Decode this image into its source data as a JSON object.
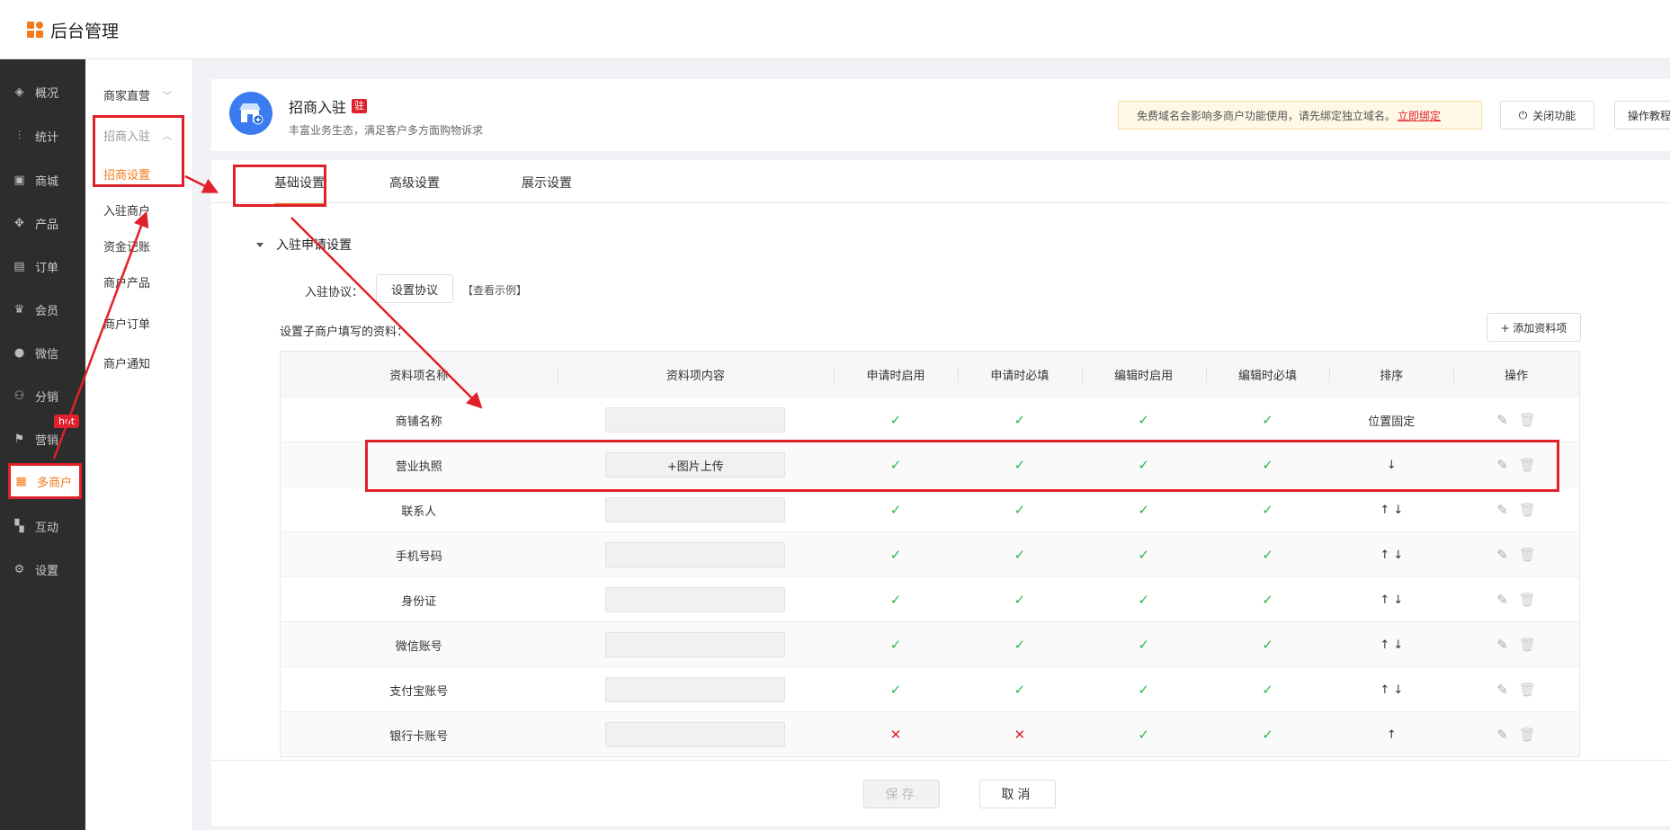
{
  "app": {
    "title": "后台管理"
  },
  "sidebar": {
    "items": [
      {
        "label": "概况",
        "icon": "layers-icon"
      },
      {
        "label": "统计",
        "icon": "stats-icon"
      },
      {
        "label": "商城",
        "icon": "shop-icon"
      },
      {
        "label": "产品",
        "icon": "grid-icon"
      },
      {
        "label": "订单",
        "icon": "order-icon"
      },
      {
        "label": "会员",
        "icon": "crown-icon"
      },
      {
        "label": "微信",
        "icon": "chat-icon"
      },
      {
        "label": "分销",
        "icon": "user-share-icon"
      },
      {
        "label": "营销",
        "icon": "flag-icon"
      },
      {
        "label": "多商户",
        "icon": "store-icon"
      },
      {
        "label": "互动",
        "icon": "apps-icon"
      },
      {
        "label": "设置",
        "icon": "gear-icon"
      }
    ],
    "hot_badge": "hot"
  },
  "submenu": {
    "group1": "商家直营",
    "group2": "招商入驻",
    "items": [
      "招商设置",
      "入驻商户",
      "资金记账",
      "商户产品",
      "商户订单",
      "商户通知"
    ]
  },
  "header": {
    "title": "招商入驻",
    "badge": "驻",
    "subtitle": "丰富业务生态，满足客户多方面购物诉求",
    "notice_text": "免费域名会影响多商户功能使用，请先绑定独立域名。",
    "notice_link": "立即绑定",
    "close_button": "关闭功能",
    "guide_button": "操作教程"
  },
  "tabs": [
    "基础设置",
    "高级设置",
    "展示设置"
  ],
  "section": {
    "title": "入驻申请设置",
    "agreement_label": "入驻协议：",
    "agreement_button": "设置协议",
    "see_example": "【查看示例】",
    "fields_label": "设置子商户填写的资料：",
    "add_button": "+ 添加资料项"
  },
  "table": {
    "headers": [
      "资料项名称",
      "资料项内容",
      "申请时启用",
      "申请时必填",
      "编辑时启用",
      "编辑时必填",
      "排序",
      "操作"
    ],
    "rows": [
      {
        "name": "商铺名称",
        "content": "",
        "flags": [
          "check",
          "check",
          "check",
          "check"
        ],
        "sort": "位置固定"
      },
      {
        "name": "营业执照",
        "content": "+图片上传",
        "flags": [
          "check",
          "check",
          "check",
          "check"
        ],
        "sort": "↓"
      },
      {
        "name": "联系人",
        "content": "",
        "flags": [
          "check",
          "check",
          "check",
          "check"
        ],
        "sort": "↑ ↓"
      },
      {
        "name": "手机号码",
        "content": "",
        "flags": [
          "check",
          "check",
          "check",
          "check"
        ],
        "sort": "↑ ↓"
      },
      {
        "name": "身份证",
        "content": "",
        "flags": [
          "check",
          "check",
          "check",
          "check"
        ],
        "sort": "↑ ↓"
      },
      {
        "name": "微信账号",
        "content": "",
        "flags": [
          "check",
          "check",
          "check",
          "check"
        ],
        "sort": "↑ ↓"
      },
      {
        "name": "支付宝账号",
        "content": "",
        "flags": [
          "check",
          "check",
          "check",
          "check"
        ],
        "sort": "↑ ↓"
      },
      {
        "name": "银行卡账号",
        "content": "",
        "flags": [
          "cross",
          "cross",
          "check",
          "check"
        ],
        "sort": "↑"
      }
    ]
  },
  "footer": {
    "save": "保存",
    "cancel": "取消"
  },
  "colors": {
    "accent": "#f37b1d",
    "annotation": "#e0202a",
    "check": "#2db84d"
  }
}
